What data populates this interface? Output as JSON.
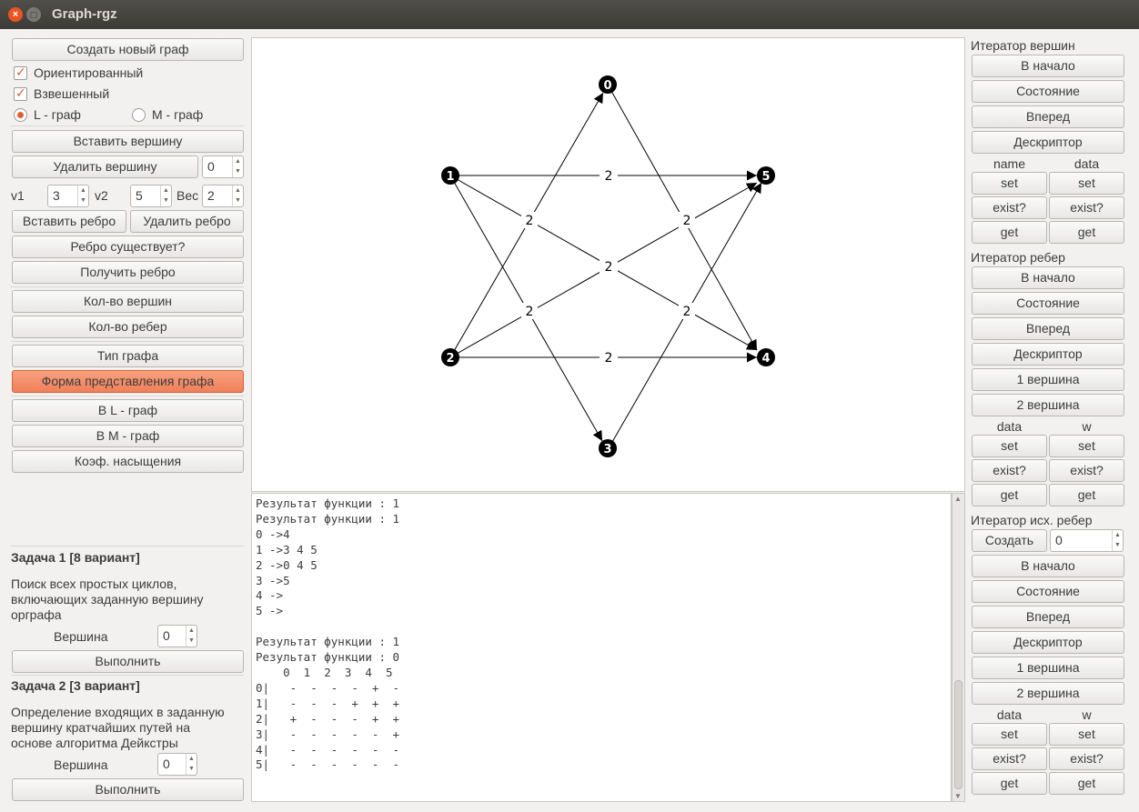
{
  "window": {
    "title": "Graph-rgz"
  },
  "left": {
    "create_graph": "Создать новый граф",
    "directed_label": "Ориентированный",
    "weighted_label": "Взвешенный",
    "l_graph_label": "L - граф",
    "m_graph_label": "M - граф",
    "insert_vertex": "Вставить вершину",
    "delete_vertex": "Удалить вершину",
    "delete_vertex_value": "0",
    "v1_label": "v1",
    "v1_value": "3",
    "v2_label": "v2",
    "v2_value": "5",
    "weight_label": "Вес",
    "weight_value": "2",
    "insert_edge": "Вставить ребро",
    "delete_edge": "Удалить ребро",
    "edge_exists": "Ребро существует?",
    "get_edge": "Получить ребро",
    "vertex_count": "Кол-во вершин",
    "edge_count": "Кол-во ребер",
    "graph_type": "Тип графа",
    "graph_form": "Форма представления графа",
    "to_l_graph": "В L - граф",
    "to_m_graph": "В M - граф",
    "saturation": "Коэф. насыщения",
    "task1_title": "Задача 1 [8 вариант]",
    "task1_desc_1": "Поиск всех простых циклов,",
    "task1_desc_2": "включающих заданную вершину",
    "task1_desc_3": "орграфа",
    "task1_vertex_label": "Вершина",
    "task1_vertex_value": "0",
    "task1_run": "Выполнить",
    "task2_title": "Задача 2 [3 вариант]",
    "task2_desc_1": "Определение входящих в заданную",
    "task2_desc_2": "вершину кратчайших путей на",
    "task2_desc_3": "основе алгоритма Дейкстры",
    "task2_vertex_label": "Вершина",
    "task2_vertex_value": "0",
    "task2_run": "Выполнить"
  },
  "graph": {
    "vertices": [
      "0",
      "1",
      "2",
      "3",
      "4",
      "5"
    ],
    "edge_weights": [
      "2",
      "2",
      "2",
      "2",
      "2",
      "2",
      "2",
      "2"
    ]
  },
  "console": {
    "lines": [
      "Результат функции : 1",
      "Результат функции : 1",
      "0 ->4",
      "1 ->3 4 5",
      "2 ->0 4 5",
      "3 ->5",
      "4 ->",
      "5 ->",
      "",
      "Результат функции : 1",
      "Результат функции : 0",
      "    0  1  2  3  4  5",
      "0|   -  -  -  -  +  -",
      "1|   -  -  -  +  +  +",
      "2|   +  -  -  -  +  +",
      "3|   -  -  -  -  -  +",
      "4|   -  -  -  -  -  -",
      "5|   -  -  -  -  -  -"
    ]
  },
  "right": {
    "vertex_iter_title": "Итератор вершин",
    "to_begin": "В начало",
    "state": "Состояние",
    "forward": "Вперед",
    "descriptor": "Дескриптор",
    "name_label": "name",
    "data_label": "data",
    "set": "set",
    "exist": "exist?",
    "get": "get",
    "edge_iter_title": "Итератор ребер",
    "vertex1": "1 вершина",
    "vertex2": "2 вершина",
    "w_label": "w",
    "out_edge_iter_title": "Итератор исх. ребер",
    "create": "Создать",
    "create_value": "0"
  }
}
